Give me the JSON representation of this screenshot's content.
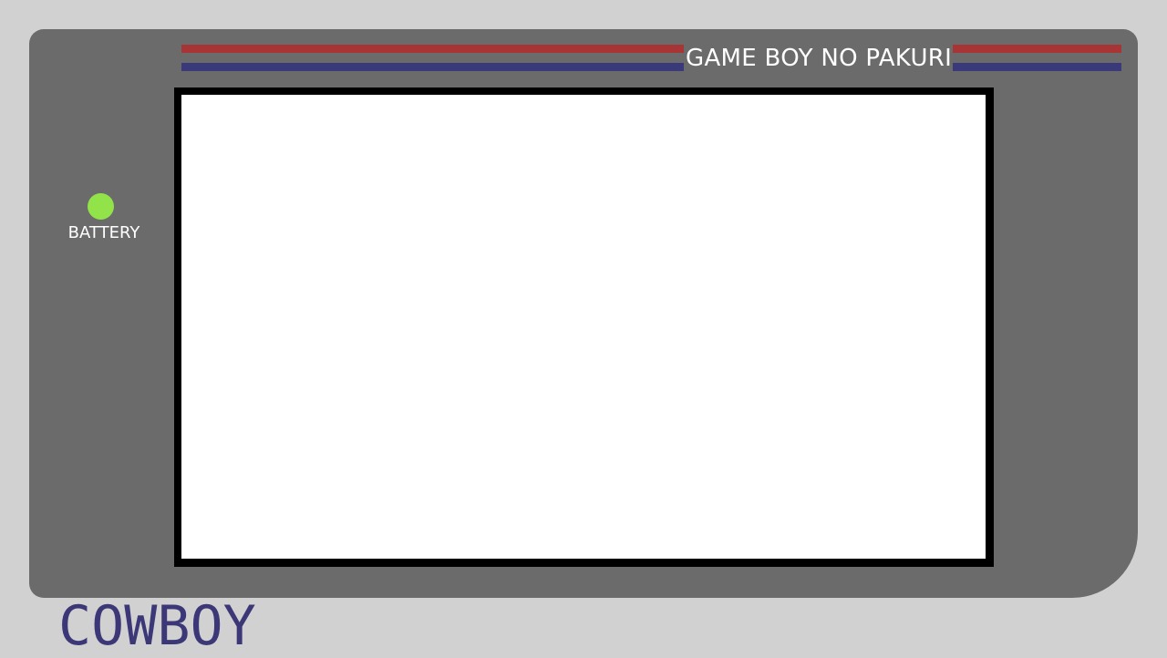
{
  "device": {
    "title": "GAME BOY NO PAKURI",
    "battery_label": "BATTERY",
    "logo": "COWBOY"
  },
  "colors": {
    "background": "#d1d1d1",
    "body": "#6b6b6b",
    "stripe_red": "#a73535",
    "stripe_blue": "#3a3a7a",
    "battery_led": "#92e24a",
    "logo": "#3c3877",
    "screen_border": "#000000",
    "screen": "#ffffff"
  }
}
